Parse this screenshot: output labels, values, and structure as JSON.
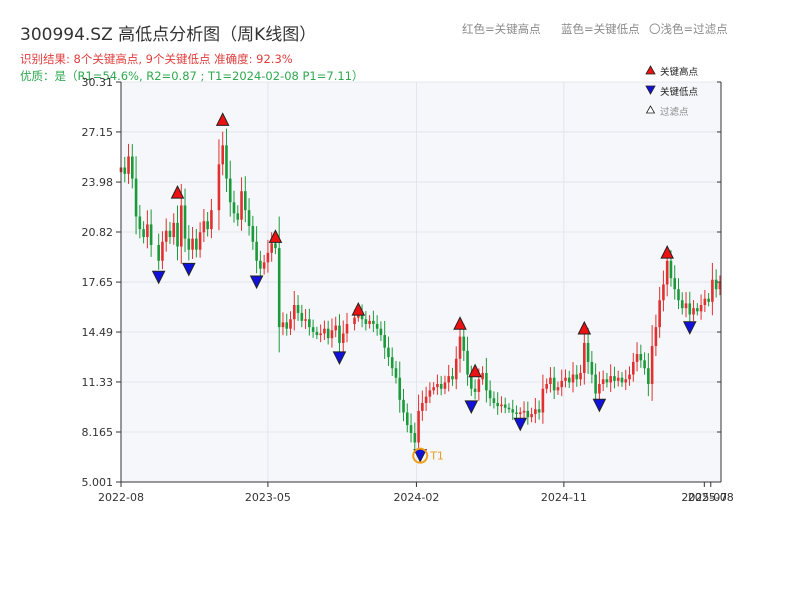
{
  "chart_data": {
    "type": "candlestick",
    "title": "300994.SZ 高低点分析图（周K线图）",
    "subtitle_result": "识别结果: 8个关键高点, 9个关键低点   准确度: 92.3%",
    "subtitle_quality": "优质：是（R1=54.6%, R2=0.87 ; T1=2024-02-08 P1=7.11）",
    "top_legend": {
      "red": "红色=关键高点",
      "blue": "蓝色=关键低点",
      "light": "〇浅色=过滤点"
    },
    "legend": {
      "high": "关键高点",
      "low": "关键低点",
      "filtered": "过滤点"
    },
    "y_ticks": [
      "5.001",
      "8.165",
      "11.33",
      "14.49",
      "17.65",
      "20.82",
      "23.98",
      "27.15",
      "30.31"
    ],
    "ylim": [
      5.001,
      30.31
    ],
    "x_ticks": [
      "2022-08",
      "2023-05",
      "2024-02",
      "2024-11",
      "2025-07",
      "2025-08"
    ],
    "xlim": [
      "2022-08-01",
      "2025-08-20"
    ],
    "closes": [
      [
        "2022-08-01",
        24.9
      ],
      [
        "2022-08-08",
        24.5
      ],
      [
        "2022-08-15",
        25.6
      ],
      [
        "2022-08-22",
        24.2
      ],
      [
        "2022-08-29",
        21.8
      ],
      [
        "2022-09-05",
        21.0
      ],
      [
        "2022-09-12",
        20.5
      ],
      [
        "2022-09-19",
        21.3
      ],
      [
        "2022-09-26",
        20.0
      ],
      [
        "2022-10-10",
        19.0
      ],
      [
        "2022-10-17",
        20.2
      ],
      [
        "2022-10-24",
        20.9
      ],
      [
        "2022-10-31",
        20.5
      ],
      [
        "2022-11-07",
        21.4
      ],
      [
        "2022-11-14",
        19.9
      ],
      [
        "2022-11-21",
        22.5
      ],
      [
        "2022-11-28",
        20.4
      ],
      [
        "2022-12-05",
        19.7
      ],
      [
        "2022-12-12",
        20.4
      ],
      [
        "2022-12-19",
        19.7
      ],
      [
        "2022-12-26",
        20.8
      ],
      [
        "2023-01-02",
        21.5
      ],
      [
        "2023-01-09",
        21.0
      ],
      [
        "2023-01-16",
        22.2
      ],
      [
        "2023-01-30",
        25.1
      ],
      [
        "2023-02-06",
        26.3
      ],
      [
        "2023-02-13",
        24.2
      ],
      [
        "2023-02-20",
        22.7
      ],
      [
        "2023-02-27",
        22.0
      ],
      [
        "2023-03-06",
        21.6
      ],
      [
        "2023-03-13",
        23.4
      ],
      [
        "2023-03-20",
        22.2
      ],
      [
        "2023-03-27",
        21.2
      ],
      [
        "2023-04-03",
        20.2
      ],
      [
        "2023-04-10",
        19.0
      ],
      [
        "2023-04-17",
        18.5
      ],
      [
        "2023-04-24",
        18.9
      ],
      [
        "2023-05-01",
        19.5
      ],
      [
        "2023-05-08",
        20.1
      ],
      [
        "2023-05-15",
        19.8
      ],
      [
        "2023-05-22",
        14.8
      ],
      [
        "2023-05-29",
        15.1
      ],
      [
        "2023-06-05",
        14.7
      ],
      [
        "2023-06-12",
        15.3
      ],
      [
        "2023-06-19",
        16.2
      ],
      [
        "2023-06-26",
        15.7
      ],
      [
        "2023-07-03",
        15.2
      ],
      [
        "2023-07-10",
        15.3
      ],
      [
        "2023-07-17",
        14.8
      ],
      [
        "2023-07-24",
        14.5
      ],
      [
        "2023-07-31",
        14.3
      ],
      [
        "2023-08-07",
        14.4
      ],
      [
        "2023-08-14",
        14.7
      ],
      [
        "2023-08-21",
        14.1
      ],
      [
        "2023-08-28",
        14.6
      ],
      [
        "2023-09-04",
        14.9
      ],
      [
        "2023-09-11",
        13.8
      ],
      [
        "2023-09-18",
        14.4
      ],
      [
        "2023-09-25",
        15.0
      ],
      [
        "2023-10-09",
        15.4
      ],
      [
        "2023-10-16",
        15.6
      ],
      [
        "2023-10-23",
        15.3
      ],
      [
        "2023-10-30",
        15.0
      ],
      [
        "2023-11-06",
        15.2
      ],
      [
        "2023-11-13",
        15.0
      ],
      [
        "2023-11-20",
        14.7
      ],
      [
        "2023-11-27",
        14.3
      ],
      [
        "2023-12-04",
        13.5
      ],
      [
        "2023-12-11",
        12.9
      ],
      [
        "2023-12-18",
        12.2
      ],
      [
        "2023-12-25",
        11.6
      ],
      [
        "2024-01-01",
        10.2
      ],
      [
        "2024-01-08",
        9.4
      ],
      [
        "2024-01-15",
        8.6
      ],
      [
        "2024-01-22",
        8.1
      ],
      [
        "2024-01-29",
        7.5
      ],
      [
        "2024-02-05",
        9.5
      ],
      [
        "2024-02-12",
        10.0
      ],
      [
        "2024-02-19",
        10.4
      ],
      [
        "2024-02-26",
        10.8
      ],
      [
        "2024-03-04",
        11.0
      ],
      [
        "2024-03-11",
        11.2
      ],
      [
        "2024-03-18",
        10.9
      ],
      [
        "2024-03-25",
        11.3
      ],
      [
        "2024-04-01",
        11.7
      ],
      [
        "2024-04-08",
        11.5
      ],
      [
        "2024-04-15",
        12.8
      ],
      [
        "2024-04-22",
        14.2
      ],
      [
        "2024-04-29",
        13.3
      ],
      [
        "2024-05-06",
        11.8
      ],
      [
        "2024-05-13",
        10.9
      ],
      [
        "2024-05-20",
        10.7
      ],
      [
        "2024-05-27",
        11.5
      ],
      [
        "2024-06-03",
        11.9
      ],
      [
        "2024-06-10",
        10.8
      ],
      [
        "2024-06-17",
        10.3
      ],
      [
        "2024-06-24",
        10.0
      ],
      [
        "2024-07-01",
        9.8
      ],
      [
        "2024-07-08",
        9.9
      ],
      [
        "2024-07-15",
        9.7
      ],
      [
        "2024-07-22",
        9.6
      ],
      [
        "2024-07-29",
        9.4
      ],
      [
        "2024-08-05",
        9.3
      ],
      [
        "2024-08-12",
        9.4
      ],
      [
        "2024-08-19",
        9.5
      ],
      [
        "2024-08-26",
        9.1
      ],
      [
        "2024-09-02",
        9.3
      ],
      [
        "2024-09-09",
        9.6
      ],
      [
        "2024-09-16",
        9.4
      ],
      [
        "2024-09-23",
        10.9
      ],
      [
        "2024-09-30",
        11.2
      ],
      [
        "2024-10-07",
        11.6
      ],
      [
        "2024-10-14",
        10.8
      ],
      [
        "2024-10-21",
        11.0
      ],
      [
        "2024-10-28",
        11.4
      ],
      [
        "2024-11-04",
        11.6
      ],
      [
        "2024-11-11",
        11.3
      ],
      [
        "2024-11-18",
        11.8
      ],
      [
        "2024-11-25",
        11.5
      ],
      [
        "2024-12-02",
        11.9
      ],
      [
        "2024-12-09",
        13.8
      ],
      [
        "2024-12-16",
        12.6
      ],
      [
        "2024-12-23",
        11.8
      ],
      [
        "2024-12-30",
        10.6
      ],
      [
        "2025-01-06",
        11.2
      ],
      [
        "2025-01-13",
        11.5
      ],
      [
        "2025-01-20",
        11.3
      ],
      [
        "2025-01-27",
        11.7
      ],
      [
        "2025-02-03",
        11.4
      ],
      [
        "2025-02-10",
        11.6
      ],
      [
        "2025-02-17",
        11.3
      ],
      [
        "2025-02-24",
        11.5
      ],
      [
        "2025-03-03",
        11.8
      ],
      [
        "2025-03-10",
        12.6
      ],
      [
        "2025-03-17",
        13.1
      ],
      [
        "2025-03-24",
        12.7
      ],
      [
        "2025-03-31",
        12.2
      ],
      [
        "2025-04-07",
        11.2
      ],
      [
        "2025-04-14",
        13.6
      ],
      [
        "2025-04-21",
        14.8
      ],
      [
        "2025-04-28",
        16.5
      ],
      [
        "2025-05-05",
        17.5
      ],
      [
        "2025-05-12",
        19.0
      ],
      [
        "2025-05-19",
        17.9
      ],
      [
        "2025-05-26",
        17.2
      ],
      [
        "2025-06-02",
        16.5
      ],
      [
        "2025-06-09",
        16.0
      ],
      [
        "2025-06-16",
        16.3
      ],
      [
        "2025-06-23",
        15.6
      ],
      [
        "2025-06-30",
        16.0
      ],
      [
        "2025-07-07",
        15.8
      ],
      [
        "2025-07-14",
        16.2
      ],
      [
        "2025-07-21",
        16.6
      ],
      [
        "2025-07-28",
        16.4
      ],
      [
        "2025-08-04",
        17.8
      ],
      [
        "2025-08-11",
        17.2
      ],
      [
        "2025-08-18",
        17.6
      ]
    ],
    "key_highs": [
      {
        "date": "2022-11-14",
        "value": 22.9
      },
      {
        "date": "2023-02-06",
        "value": 27.5
      },
      {
        "date": "2023-05-15",
        "value": 20.1
      },
      {
        "date": "2023-10-16",
        "value": 15.5
      },
      {
        "date": "2024-04-22",
        "value": 14.6
      },
      {
        "date": "2024-05-20",
        "value": 11.6
      },
      {
        "date": "2024-12-09",
        "value": 14.3
      },
      {
        "date": "2025-05-12",
        "value": 19.1
      }
    ],
    "key_lows": [
      {
        "date": "2022-10-10",
        "value": 18.4
      },
      {
        "date": "2022-12-05",
        "value": 18.9
      },
      {
        "date": "2023-04-10",
        "value": 18.1
      },
      {
        "date": "2023-09-11",
        "value": 13.3
      },
      {
        "date": "2024-02-08",
        "value": 7.11
      },
      {
        "date": "2024-05-13",
        "value": 10.2
      },
      {
        "date": "2024-08-12",
        "value": 9.1
      },
      {
        "date": "2025-01-06",
        "value": 10.3
      },
      {
        "date": "2025-06-23",
        "value": 15.2
      }
    ],
    "t1_marker": {
      "label": "T1",
      "date": "2024-02-08",
      "value": 7.11
    },
    "colors": {
      "up": "#e03030",
      "down": "#1b9a3a",
      "high_marker": "#ee1111",
      "low_marker": "#1111dd",
      "t1": "#f0a020",
      "plot_bg": "#f6f7fa",
      "grid": "#dde2ea"
    },
    "grid": true
  }
}
